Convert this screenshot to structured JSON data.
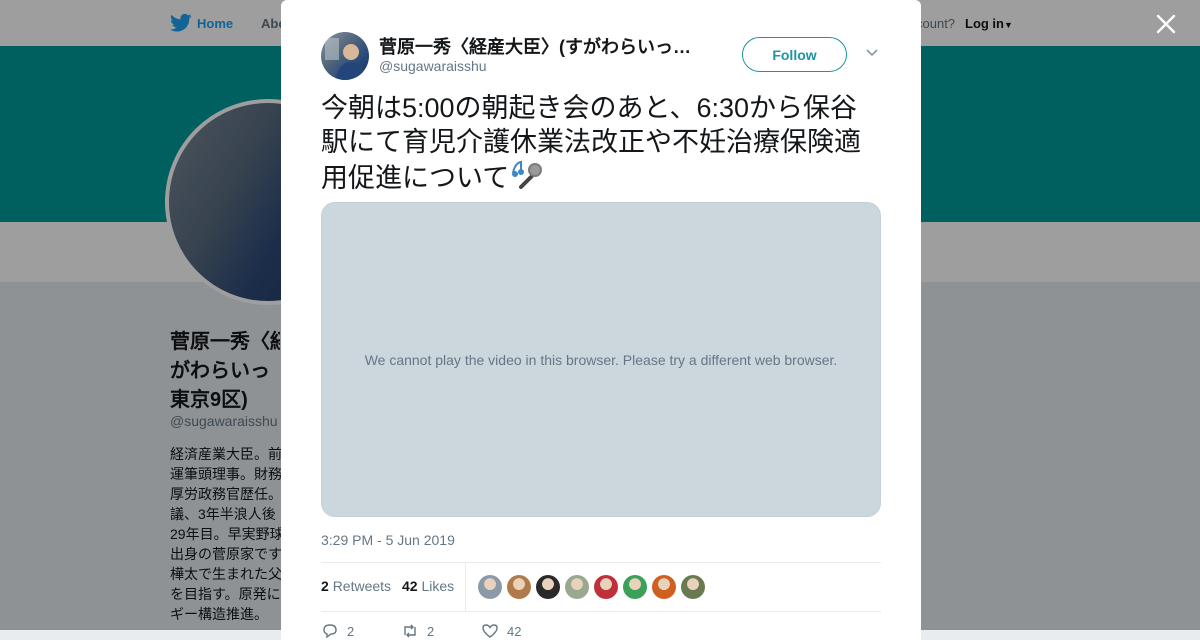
{
  "topnav": {
    "home_label": "Home",
    "about_label": "Abo",
    "account_prompt": "count?",
    "login_label": "Log in"
  },
  "profile": {
    "name_lines": [
      "菅原一秀〈経",
      "がわらいっ",
      "東京9区)"
    ],
    "handle": "@sugawaraisshu",
    "bio_lines": [
      "経済産業大臣。前",
      "運筆頭理事。財務",
      "厚労政務官歴任。",
      "議、3年半浪人後",
      "29年目。早実野球",
      "出身の菅原家です",
      "樺太で生まれた父",
      "を目指す。原発に",
      "ギー構造推進。"
    ]
  },
  "tweet": {
    "author_name": "菅原一秀〈経産大臣〉(すがわらいっしゅう)",
    "author_handle": "@sugawaraisshu",
    "follow_label": "Follow",
    "text": "今朝は5:00の朝起き会のあと、6:30から保谷駅にて育児介護休業法改正や不妊治療保険適用促進について",
    "media_message": "We cannot play the video in this browser. Please try a different web browser.",
    "timestamp": "3:29 PM - 5 Jun 2019",
    "retweet_count": "2",
    "retweet_label": "Retweets",
    "like_count": "42",
    "like_label": "Likes",
    "reply_count": "2",
    "action_retweet_count": "2",
    "action_like_count": "42"
  },
  "colors": {
    "banner": "#009999",
    "follow": "#1b95a0",
    "twitter_blue": "#1da1f2"
  },
  "likers": [
    {
      "name": "liker-avatar",
      "color": "#8a9aa8"
    },
    {
      "name": "liker-avatar",
      "color": "#b07a4a"
    },
    {
      "name": "liker-avatar",
      "color": "#2a2a2a"
    },
    {
      "name": "liker-avatar",
      "color": "#9aa890"
    },
    {
      "name": "liker-avatar",
      "color": "#c0303a"
    },
    {
      "name": "liker-avatar",
      "color": "#3aa05a"
    },
    {
      "name": "liker-avatar",
      "color": "#d06020"
    },
    {
      "name": "liker-avatar",
      "color": "#6a7a50"
    }
  ]
}
